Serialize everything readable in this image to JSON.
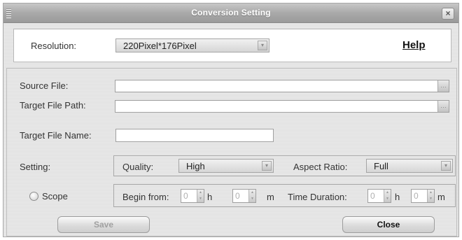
{
  "window": {
    "title": "Conversion Setting",
    "close_glyph": "×"
  },
  "resolution": {
    "label": "Resolution:",
    "value": "220Pixel*176Pixel"
  },
  "help": {
    "label": "Help"
  },
  "source_file": {
    "label": "Source File:",
    "value": ""
  },
  "target_path": {
    "label": "Target File Path:",
    "value": ""
  },
  "target_name": {
    "label": "Target File Name:",
    "value": ""
  },
  "setting": {
    "label": "Setting:",
    "quality_label": "Quality:",
    "quality_value": "High",
    "aspect_label": "Aspect Ratio:",
    "aspect_value": "Full"
  },
  "scope": {
    "label": "Scope",
    "checked": false,
    "begin_label": "Begin from:",
    "begin_h": "0",
    "h_unit": "h",
    "begin_m": "0",
    "m_unit": "m",
    "duration_label": "Time Duration:",
    "dur_h": "0",
    "dur_m": "0"
  },
  "buttons": {
    "save": "Save",
    "close": "Close"
  },
  "icons": {
    "dropdown": "chevron-down-icon",
    "browse": "browse-icon",
    "spinner": "spinner-arrows-icon",
    "close": "close-icon",
    "grip": "grip-icon"
  },
  "colors": {
    "titlebar": "#a9a9a9",
    "panel_bg": "#e6e6e6",
    "disabled_text": "#a0a0a0"
  }
}
